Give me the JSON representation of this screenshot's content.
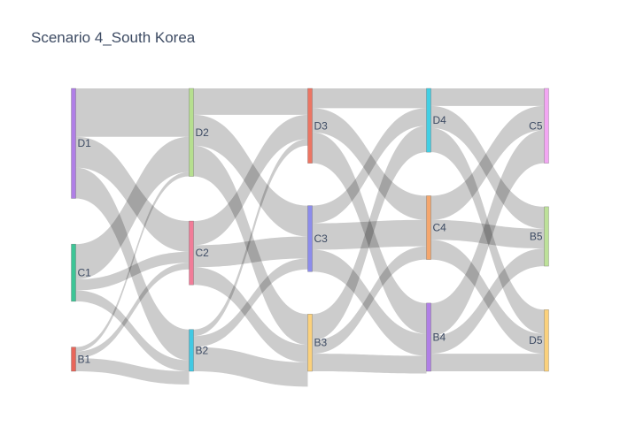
{
  "chart_data": {
    "type": "sankey",
    "title": "Scenario 4_South Korea",
    "link_color": "#000000",
    "link_opacity": 0.2,
    "columns": [
      {
        "nodes": [
          {
            "id": "D1",
            "label": "D1",
            "value": 50,
            "color": "#b07fe6"
          },
          {
            "id": "C1",
            "label": "C1",
            "value": 26,
            "color": "#3dc596"
          },
          {
            "id": "B1",
            "label": "B1",
            "value": 11,
            "color": "#e8665a"
          }
        ]
      },
      {
        "nodes": [
          {
            "id": "D2",
            "label": "D2",
            "value": 40,
            "color": "#b6df8f"
          },
          {
            "id": "C2",
            "label": "C2",
            "value": 29,
            "color": "#f17c98"
          },
          {
            "id": "B2",
            "label": "B2",
            "value": 19,
            "color": "#42c9e3"
          }
        ]
      },
      {
        "nodes": [
          {
            "id": "D3",
            "label": "D3",
            "value": 34,
            "color": "#ec7563"
          },
          {
            "id": "C3",
            "label": "C3",
            "value": 30,
            "color": "#8c8cec"
          },
          {
            "id": "B3",
            "label": "B3",
            "value": 26,
            "color": "#fbd17c"
          }
        ]
      },
      {
        "nodes": [
          {
            "id": "D4",
            "label": "D4",
            "value": 29,
            "color": "#42cfe4"
          },
          {
            "id": "C4",
            "label": "C4",
            "value": 29,
            "color": "#f5a66d"
          },
          {
            "id": "B4",
            "label": "B4",
            "value": 31,
            "color": "#b07fe6"
          }
        ]
      },
      {
        "nodes": [
          {
            "id": "C5",
            "label": "C5",
            "value": 34,
            "color": "#f2a6f2"
          },
          {
            "id": "B5",
            "label": "B5",
            "value": 27,
            "color": "#bde199"
          },
          {
            "id": "D5",
            "label": "D5",
            "value": 28,
            "color": "#fbd17c"
          }
        ]
      }
    ],
    "links": [
      {
        "source": "D1",
        "target": "D2",
        "value": 22
      },
      {
        "source": "D1",
        "target": "C2",
        "value": 14
      },
      {
        "source": "D1",
        "target": "B2",
        "value": 14
      },
      {
        "source": "C1",
        "target": "D2",
        "value": 16
      },
      {
        "source": "C1",
        "target": "C2",
        "value": 5
      },
      {
        "source": "C1",
        "target": "B2",
        "value": 5
      },
      {
        "source": "B1",
        "target": "D2",
        "value": 2
      },
      {
        "source": "B1",
        "target": "C2",
        "value": 3
      },
      {
        "source": "B1",
        "target": "B2",
        "value": 6
      },
      {
        "source": "D2",
        "target": "D3",
        "value": 12
      },
      {
        "source": "D2",
        "target": "C3",
        "value": 14
      },
      {
        "source": "D2",
        "target": "B3",
        "value": 14
      },
      {
        "source": "C2",
        "target": "D3",
        "value": 11
      },
      {
        "source": "C2",
        "target": "C3",
        "value": 10
      },
      {
        "source": "C2",
        "target": "B3",
        "value": 8
      },
      {
        "source": "B2",
        "target": "D3",
        "value": 3
      },
      {
        "source": "B2",
        "target": "C3",
        "value": 5
      },
      {
        "source": "B2",
        "target": "B3",
        "value": 11
      },
      {
        "source": "D3",
        "target": "D4",
        "value": 9
      },
      {
        "source": "D3",
        "target": "C4",
        "value": 11
      },
      {
        "source": "D3",
        "target": "B4",
        "value": 14
      },
      {
        "source": "C3",
        "target": "D4",
        "value": 8
      },
      {
        "source": "C3",
        "target": "C4",
        "value": 12
      },
      {
        "source": "C3",
        "target": "B4",
        "value": 10
      },
      {
        "source": "B3",
        "target": "D4",
        "value": 12
      },
      {
        "source": "B3",
        "target": "C4",
        "value": 6
      },
      {
        "source": "B3",
        "target": "B4",
        "value": 8
      },
      {
        "source": "D4",
        "target": "C5",
        "value": 8
      },
      {
        "source": "D4",
        "target": "B5",
        "value": 10
      },
      {
        "source": "D4",
        "target": "D5",
        "value": 11
      },
      {
        "source": "C4",
        "target": "C5",
        "value": 11
      },
      {
        "source": "C4",
        "target": "B5",
        "value": 9
      },
      {
        "source": "C4",
        "target": "D5",
        "value": 9
      },
      {
        "source": "B4",
        "target": "C5",
        "value": 15
      },
      {
        "source": "B4",
        "target": "B5",
        "value": 8
      },
      {
        "source": "B4",
        "target": "D5",
        "value": 8
      }
    ]
  }
}
